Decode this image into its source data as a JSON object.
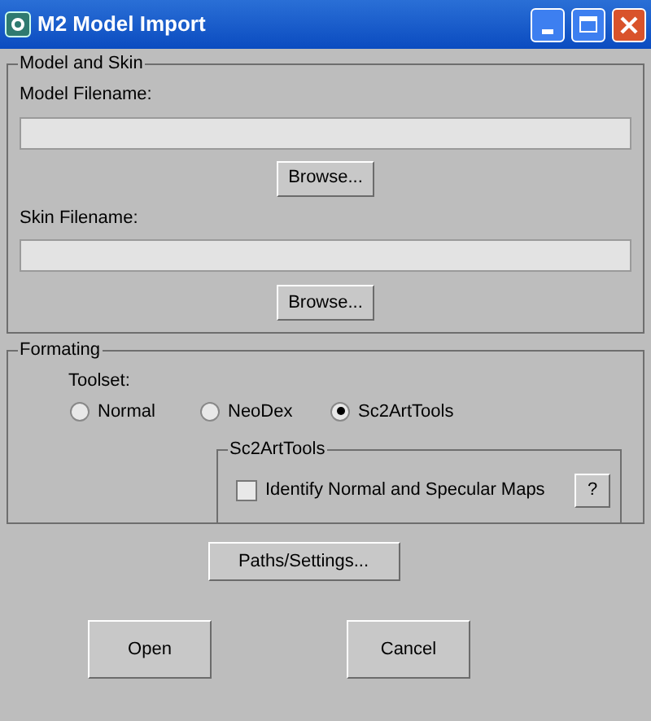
{
  "window": {
    "title": "M2 Model Import"
  },
  "model_and_skin": {
    "title": "Model and Skin",
    "model_label": "Model Filename:",
    "model_browse": "Browse...",
    "skin_label": "Skin Filename:",
    "skin_browse": "Browse..."
  },
  "formatting": {
    "title": "Formating",
    "toolset_label": "Toolset:",
    "options": [
      {
        "label": "Normal",
        "selected": false
      },
      {
        "label": "NeoDex",
        "selected": false
      },
      {
        "label": "Sc2ArtTools",
        "selected": true
      }
    ],
    "sub_group": {
      "title": "Sc2ArtTools",
      "checkbox": {
        "label": "Identify Normal and Specular Maps",
        "checked": false
      },
      "help": "?"
    }
  },
  "paths_button": "Paths/Settings...",
  "buttons": [
    "Open",
    "Cancel"
  ]
}
